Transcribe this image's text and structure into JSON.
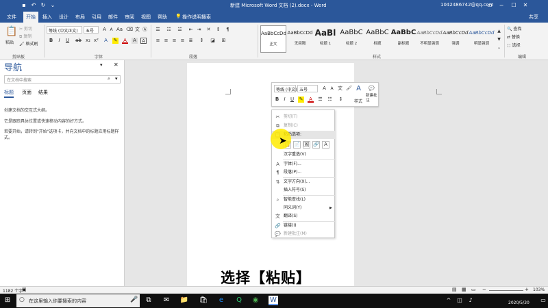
{
  "titlebar": {
    "save_icon": "save-icon",
    "title": "新建 Microsoft Word 文档 (2).docx - Word",
    "account": "1042486742@qq.com"
  },
  "tabs": [
    "文件",
    "开始",
    "插入",
    "设计",
    "布局",
    "引用",
    "邮件",
    "审阅",
    "视图",
    "帮助"
  ],
  "tell_me": "操作说明搜索",
  "share": "共享",
  "ribbon": {
    "clipboard": {
      "paste": "粘贴",
      "cut": "剪切",
      "copy": "复制",
      "format_painter": "格式刷",
      "label": "剪贴板"
    },
    "font": {
      "font_name": "等线 (中文正文)",
      "font_size": "五号",
      "label": "字体"
    },
    "paragraph": {
      "label": "段落"
    },
    "styles": {
      "label": "样式",
      "items": [
        {
          "preview": "AaBbCcDd",
          "name": "正文"
        },
        {
          "preview": "AaBbCcDd",
          "name": "无间隔"
        },
        {
          "preview": "AaBl",
          "name": "标题 1"
        },
        {
          "preview": "AaBbC",
          "name": "标题 2"
        },
        {
          "preview": "AaBbC",
          "name": "标题"
        },
        {
          "preview": "AaBbC",
          "name": "副标题"
        },
        {
          "preview": "AaBbCcDd",
          "name": "不明显强调"
        },
        {
          "preview": "AaBbCcDd",
          "name": "强调"
        },
        {
          "preview": "AaBbCcDd",
          "name": "明显强调"
        }
      ]
    },
    "editing": {
      "find": "查找",
      "replace": "替换",
      "select": "选择",
      "label": "编辑"
    }
  },
  "nav": {
    "title": "导航",
    "search_placeholder": "在文档中搜索",
    "tabs": [
      "标题",
      "页面",
      "结果"
    ],
    "lines": [
      "创建文档的交互式大纲。",
      "它是跟踪具体位置或快速移动内容的好方式。",
      "若要开始，请转到\"开始\"选项卡，并向文档中的标题应用标题样式。"
    ]
  },
  "minitoolbar": {
    "font": "等线 (中文)",
    "size": "五号",
    "styles": "样式",
    "new_comment": "新建批注"
  },
  "context_menu": {
    "cut": "剪切(T)",
    "copy": "复制(C)",
    "paste_options": "粘贴选项:",
    "hanzi": "汉字重选(V)",
    "font": "字体(F)...",
    "paragraph": "段落(P)...",
    "text_direction": "文字方向(X)...",
    "insert_symbol": "插入符号(S)",
    "smart_lookup": "智能查找(L)",
    "synonyms": "同义词(Y)",
    "translate": "翻译(S)",
    "link": "链接(I)",
    "new_comment": "新建批注(M)"
  },
  "status": {
    "word_count": "1182 个字",
    "zoom": "103%"
  },
  "taskbar": {
    "search_placeholder": "在这里输入你要搜索的内容",
    "date": "2020/5/30"
  },
  "subtitle": "选择【粘贴】",
  "colors": {
    "word_blue": "#2b579a",
    "highlight": "#ffeb00"
  }
}
